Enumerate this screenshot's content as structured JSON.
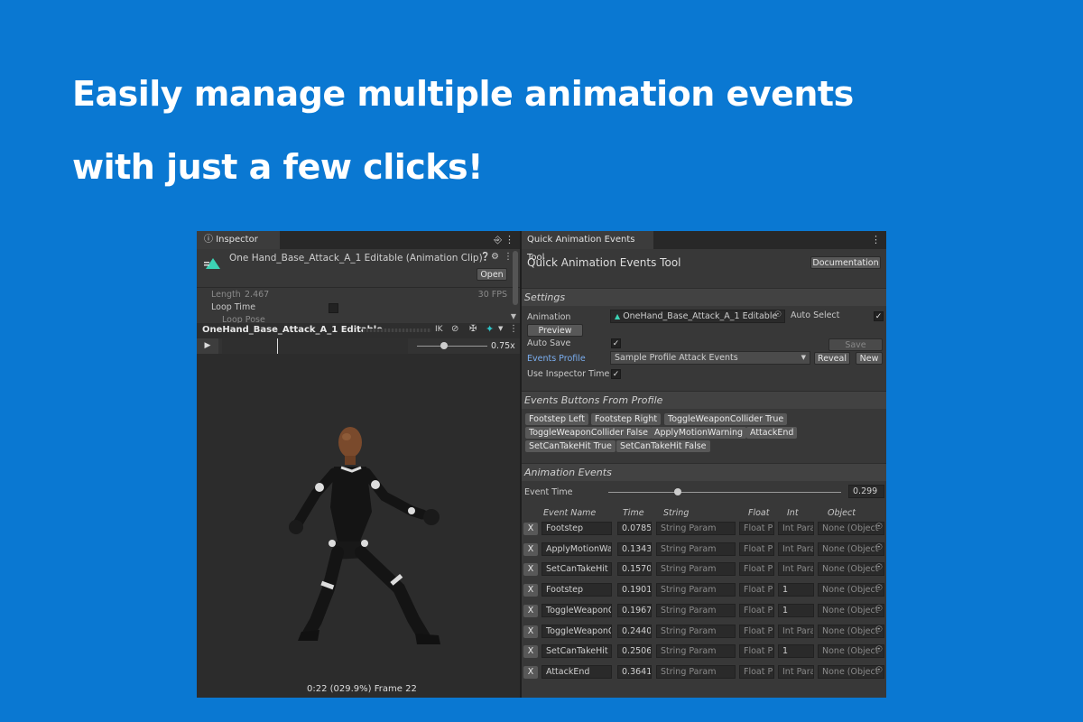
{
  "headline": {
    "line1": "Easily manage multiple animation events",
    "line2": "with just a few clicks!"
  },
  "colors": {
    "background": "#0a78d2",
    "accent": "#3a9de0"
  },
  "inspector": {
    "tab_label": "Inspector",
    "clip_title": "One Hand_Base_Attack_A_1 Editable (Animation Clip)",
    "open_label": "Open",
    "length_label": "Length",
    "length_value": "2.467",
    "fps": "30 FPS",
    "loop_time_label": "Loop Time",
    "loop_pose_label": "Loop Pose",
    "preview_name": "OneHand_Base_Attack_A_1 Editable",
    "ik_label": "IK",
    "speed": "0.75x",
    "status": "0:22 (029.9%) Frame 22"
  },
  "tool": {
    "tab_label": "Quick Animation Events Tool",
    "title": "Quick Animation Events Tool",
    "documentation_label": "Documentation",
    "settings_header": "Settings",
    "animation_label": "Animation",
    "animation_value": "OneHand_Base_Attack_A_1 Editable",
    "auto_select_label": "Auto Select",
    "preview_label": "Preview",
    "auto_save_label": "Auto Save",
    "save_label": "Save",
    "events_profile_label": "Events Profile",
    "events_profile_value": "Sample Profile Attack Events",
    "reveal_label": "Reveal",
    "new_label": "New",
    "use_inspector_time_label": "Use Inspector Time",
    "buttons_header": "Events Buttons From Profile",
    "event_buttons": [
      "Footstep Left",
      "Footstep Right",
      "ToggleWeaponCollider True",
      "ToggleWeaponCollider False",
      "ApplyMotionWarning",
      "AttackEnd",
      "SetCanTakeHit True",
      "SetCanTakeHit False"
    ],
    "events_header": "Animation Events",
    "event_time_label": "Event Time",
    "event_time_value": "0.299",
    "event_time_fraction": 0.299,
    "columns": {
      "name": "Event Name",
      "time": "Time",
      "string": "String",
      "float": "Float",
      "int": "Int",
      "object": "Object"
    },
    "events": [
      {
        "x": "X",
        "name": "Footstep",
        "time": "0.0785",
        "string": "String Param",
        "float": "Float P",
        "int": "Int Para",
        "object": "None (Object"
      },
      {
        "x": "X",
        "name": "ApplyMotionWar",
        "time": "0.1343",
        "string": "String Param",
        "float": "Float P",
        "int": "Int Para",
        "object": "None (Object"
      },
      {
        "x": "X",
        "name": "SetCanTakeHit",
        "time": "0.1570",
        "string": "String Param",
        "float": "Float P",
        "int": "Int Para",
        "object": "None (Object"
      },
      {
        "x": "X",
        "name": "Footstep",
        "time": "0.1901",
        "string": "String Param",
        "float": "Float P",
        "int": "1",
        "object": "None (Object"
      },
      {
        "x": "X",
        "name": "ToggleWeaponC",
        "time": "0.1967",
        "string": "String Param",
        "float": "Float P",
        "int": "1",
        "object": "None (Object"
      },
      {
        "x": "X",
        "name": "ToggleWeaponC",
        "time": "0.2440",
        "string": "String Param",
        "float": "Float P",
        "int": "Int Para",
        "object": "None (Object"
      },
      {
        "x": "X",
        "name": "SetCanTakeHit",
        "time": "0.2506",
        "string": "String Param",
        "float": "Float P",
        "int": "1",
        "object": "None (Object"
      },
      {
        "x": "X",
        "name": "AttackEnd",
        "time": "0.3641",
        "string": "String Param",
        "float": "Float P",
        "int": "Int Para",
        "object": "None (Object"
      }
    ]
  }
}
